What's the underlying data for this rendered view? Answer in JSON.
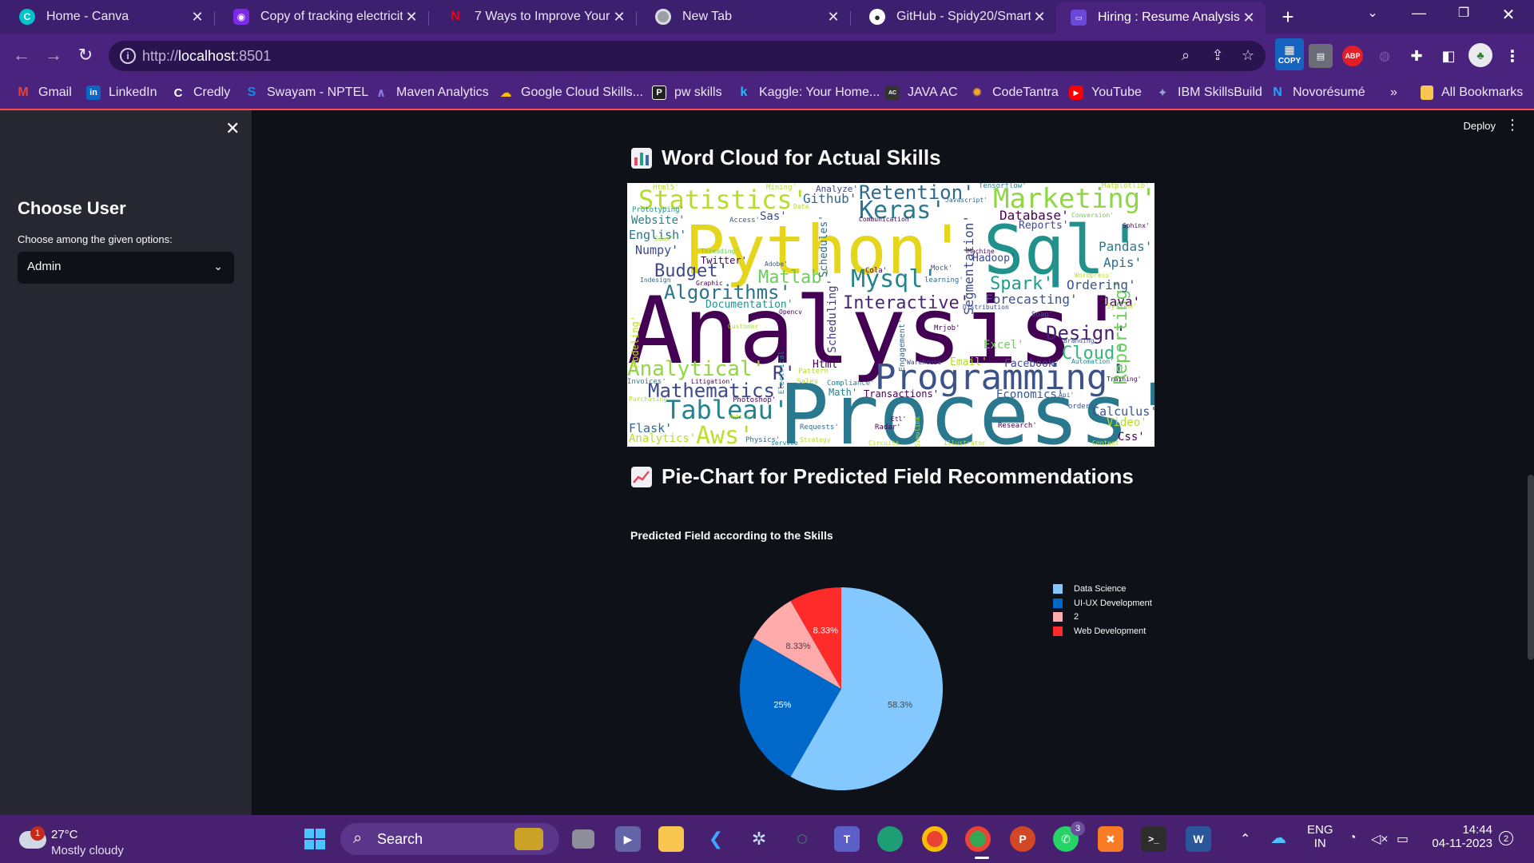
{
  "browser": {
    "tabs": [
      {
        "title": "Home - Canva",
        "favicon": "canva-icon",
        "color": "#00c4cc"
      },
      {
        "title": "Copy of tracking electricity",
        "favicon": "app-icon",
        "color": "#7d2ae8"
      },
      {
        "title": "7 Ways to Improve Your W",
        "favicon": "n-icon",
        "color": "#e50914"
      },
      {
        "title": "New Tab",
        "favicon": "chrome-icon",
        "color": "#9aa0a6"
      },
      {
        "title": "GitHub - Spidy20/Smart_R",
        "favicon": "github-icon",
        "color": "#ffffff"
      },
      {
        "title": "Hiring : Resume Analysis",
        "favicon": "hiring-icon",
        "color": "#6b48d9"
      }
    ],
    "url_prefix": "http://",
    "url_host": "localhost",
    "url_port": ":8501",
    "bookmarks": [
      {
        "label": "Gmail",
        "icon": "gmail-icon",
        "color": "#ea4335"
      },
      {
        "label": "LinkedIn",
        "icon": "linkedin-icon",
        "color": "#0a66c2"
      },
      {
        "label": "Credly",
        "icon": "credly-icon",
        "color": "#ff6b00"
      },
      {
        "label": "Swayam - NPTEL",
        "icon": "swayam-icon",
        "color": "#1976d2"
      },
      {
        "label": "Maven Analytics",
        "icon": "maven-icon",
        "color": "#6b5bd6"
      },
      {
        "label": "Google Cloud Skills...",
        "icon": "google-cloud-icon",
        "color": "#4285f4"
      },
      {
        "label": "pw skills",
        "icon": "pw-icon",
        "color": "#222222"
      },
      {
        "label": "Kaggle: Your Home...",
        "icon": "kaggle-icon",
        "color": "#20beff"
      },
      {
        "label": "JAVA AC",
        "icon": "java-icon",
        "color": "#333333"
      },
      {
        "label": "CodeTantra",
        "icon": "codetantra-icon",
        "color": "#f5a623"
      },
      {
        "label": "YouTube",
        "icon": "youtube-icon",
        "color": "#ff0000"
      },
      {
        "label": "IBM SkillsBuild",
        "icon": "ibm-icon",
        "color": "#3d70b2"
      },
      {
        "label": "Novorésumé",
        "icon": "novoresume-icon",
        "color": "#1ea7fd"
      }
    ],
    "bookmarks_more": "»",
    "all_bookmarks": "All Bookmarks",
    "copy_ext": "COPY",
    "abp_ext": "ABP"
  },
  "sidebar": {
    "title": "Choose User",
    "select_label": "Choose among the given options:",
    "select_value": "Admin"
  },
  "header": {
    "deploy": "Deploy"
  },
  "wordcloud_section": {
    "title": "Word Cloud for Actual Skills",
    "words": [
      {
        "t": "Analysis'",
        "c": "#440154"
      },
      {
        "t": "Process'",
        "c": "#2a788e"
      },
      {
        "t": "Python'",
        "c": "#e5d51c"
      },
      {
        "t": "Sql'",
        "c": "#21918c"
      },
      {
        "t": "Programming'",
        "c": "#3b528b"
      },
      {
        "t": "Statistics'",
        "c": "#b5de2b"
      },
      {
        "t": "Marketing'",
        "c": "#8fd744"
      },
      {
        "t": "Keras'",
        "c": "#2a788e"
      },
      {
        "t": "Retention'",
        "c": "#31688e"
      },
      {
        "t": "Tableau'",
        "c": "#26828e"
      },
      {
        "t": "Mathematics'",
        "c": "#3e4989"
      },
      {
        "t": "Analytical'",
        "c": "#8fd744"
      },
      {
        "t": "Algorithms'",
        "c": "#2c728e"
      },
      {
        "t": "Mysql'",
        "c": "#25858e"
      },
      {
        "t": "Interactive'",
        "c": "#482677"
      },
      {
        "t": "Design'",
        "c": "#481f70"
      },
      {
        "t": "Spark'",
        "c": "#1f9e89"
      },
      {
        "t": "Cloud'",
        "c": "#35b779"
      },
      {
        "t": "Matlab'",
        "c": "#6ccd5a"
      },
      {
        "t": "Budget'",
        "c": "#3e4989"
      },
      {
        "t": "Aws'",
        "c": "#bddf26"
      },
      {
        "t": "Reporting'",
        "c": "#6ccd5a"
      },
      {
        "t": "Forecasting'",
        "c": "#3b528b"
      },
      {
        "t": "Database'",
        "c": "#440154"
      },
      {
        "t": "Pandas'",
        "c": "#2a788e"
      },
      {
        "t": "Apis'",
        "c": "#31688e"
      },
      {
        "t": "Ordering'",
        "c": "#39568c"
      },
      {
        "t": "Java'",
        "c": "#440154"
      },
      {
        "t": "Scheduling'",
        "c": "#453781"
      },
      {
        "t": "Segmentation'",
        "c": "#3e4989"
      },
      {
        "t": "Schedules'",
        "c": "#31688e"
      },
      {
        "t": "Github'",
        "c": "#31688e"
      },
      {
        "t": "Website'",
        "c": "#26828e"
      },
      {
        "t": "English'",
        "c": "#2a788e"
      },
      {
        "t": "Numpy'",
        "c": "#3e4989"
      },
      {
        "t": "Sas'",
        "c": "#3e4989"
      },
      {
        "t": "Flask'",
        "c": "#31688e"
      },
      {
        "t": "Analytics'",
        "c": "#b5de2b"
      },
      {
        "t": "Calculus'",
        "c": "#39568c"
      },
      {
        "t": "Video'",
        "c": "#b5de2b"
      },
      {
        "t": "Css'",
        "c": "#440154"
      },
      {
        "t": "Economics'",
        "c": "#39568c"
      },
      {
        "t": "Facebook'",
        "c": "#3e4989"
      },
      {
        "t": "Excel'",
        "c": "#6ccd5a"
      },
      {
        "t": "Email'",
        "c": "#b5de2b"
      },
      {
        "t": "Html'",
        "c": "#440154"
      },
      {
        "t": "R'",
        "c": "#443983"
      },
      {
        "t": "Reports'",
        "c": "#3e4989"
      },
      {
        "t": "Hadoop'",
        "c": "#3e4989"
      },
      {
        "t": "Twitter'",
        "c": "#440154"
      },
      {
        "t": "Documentation'",
        "c": "#21918c"
      },
      {
        "t": "Transactions'",
        "c": "#440154"
      },
      {
        "t": "Math'",
        "c": "#26828e"
      },
      {
        "t": "Modeling'",
        "c": "#bddf26"
      },
      {
        "t": "Engagement'",
        "c": "#31688e"
      },
      {
        "t": "Analyze'",
        "c": "#3e4989"
      },
      {
        "t": "Mining'",
        "c": "#b5de2b"
      },
      {
        "t": "Tensorflow'",
        "c": "#26828e"
      },
      {
        "t": "Matplotlib'",
        "c": "#b5de2b"
      },
      {
        "t": "Html5'",
        "c": "#b5de2b"
      },
      {
        "t": "Prototyping'",
        "c": "#21918c"
      },
      {
        "t": "Access'",
        "c": "#39568c"
      },
      {
        "t": "Javascript'",
        "c": "#31688e"
      },
      {
        "t": "Communication'",
        "c": "#440154"
      },
      {
        "t": "Conversion'",
        "c": "#6ccd5a"
      },
      {
        "t": "Sphinx'",
        "c": "#440154"
      },
      {
        "t": "Threading'",
        "c": "#6ccd5a"
      },
      {
        "t": "Adobe'",
        "c": "#39568c"
      },
      {
        "t": "Machine",
        "c": "#440154"
      },
      {
        "t": "Wordpress'",
        "c": "#b5de2b"
      },
      {
        "t": "Cola'",
        "c": "#440154"
      },
      {
        "t": "Mock'",
        "c": "#39568c"
      },
      {
        "t": "learning'",
        "c": "#31688e"
      },
      {
        "t": "Indesign",
        "c": "#31688e"
      },
      {
        "t": "Graphic",
        "c": "#440154"
      },
      {
        "t": "Distribution",
        "c": "#3e4989"
      },
      {
        "t": "Soap'",
        "c": "#39568c"
      },
      {
        "t": "System'",
        "c": "#b5de2b"
      },
      {
        "t": "Opencv",
        "c": "#440154"
      },
      {
        "t": "Customer",
        "c": "#b5de2b"
      },
      {
        "t": "Electrical",
        "c": "#26828e"
      },
      {
        "t": "Mrjob'",
        "c": "#440154"
      },
      {
        "t": "Branding'",
        "c": "#39568c"
      },
      {
        "t": "Automation'",
        "c": "#26828e"
      },
      {
        "t": "Warehouse'",
        "c": "#3e4989"
      },
      {
        "t": "Training'",
        "c": "#440154"
      },
      {
        "t": "Invoices'",
        "c": "#26828e"
      },
      {
        "t": "Litigation'",
        "c": "#440154"
      },
      {
        "t": "Pattern",
        "c": "#b5de2b"
      },
      {
        "t": "Sales",
        "c": "#b5de2b"
      },
      {
        "t": "Compliance'",
        "c": "#26828e"
      },
      {
        "t": "Purchasing",
        "c": "#b5de2b"
      },
      {
        "t": "Photoshop'",
        "c": "#440154"
      },
      {
        "t": "Api'",
        "c": "#39568c"
      },
      {
        "t": "orders'",
        "c": "#39568c"
      },
      {
        "t": "Etl'",
        "c": "#440154"
      },
      {
        "t": "Research'",
        "c": "#440154"
      },
      {
        "t": "Requests'",
        "c": "#31688e"
      },
      {
        "t": "Radar'",
        "c": "#440154"
      },
      {
        "t": "Physics'",
        "c": "#31688e"
      },
      {
        "t": "Strategy",
        "c": "#b5de2b"
      },
      {
        "t": "service",
        "c": "#26828e"
      },
      {
        "t": "Mobile",
        "c": "#b5de2b"
      },
      {
        "t": "Saas'",
        "c": "#b5de2b"
      },
      {
        "t": "Data",
        "c": "#b5de2b"
      },
      {
        "t": "Circuits",
        "c": "#b5de2b"
      },
      {
        "t": "Illustrator",
        "c": "#b5de2b"
      },
      {
        "t": "Content",
        "c": "#b5de2b"
      },
      {
        "t": "Simulink",
        "c": "#b5de2b"
      }
    ]
  },
  "pie_section": {
    "title": "Pie-Chart for Predicted Field Recommendations"
  },
  "chart_data": {
    "type": "pie",
    "title": "Predicted Field according to the Skills",
    "legend_position": "right",
    "slices": [
      {
        "label": "Data Science",
        "percent": 58.3,
        "display": "58.3%",
        "color": "#83c9ff",
        "text_color": "#444444"
      },
      {
        "label": "UI-UX Development",
        "percent": 25,
        "display": "25%",
        "color": "#0068c9",
        "text_color": "#ffffff"
      },
      {
        "label": "2",
        "percent": 8.33,
        "display": "8.33%",
        "color": "#ffabab",
        "text_color": "#444444"
      },
      {
        "label": "Web Development",
        "percent": 8.33,
        "display": "8.33%",
        "color": "#ff2b2b",
        "text_color": "#ffffff"
      }
    ]
  },
  "taskbar": {
    "temp": "27°C",
    "condition": "Mostly cloudy",
    "weather_badge": "1",
    "search_label": "Search",
    "lang_top": "ENG",
    "lang_bottom": "IN",
    "time": "14:44",
    "date": "04-11-2023",
    "notif_count": "2",
    "teams_badge": "3"
  }
}
